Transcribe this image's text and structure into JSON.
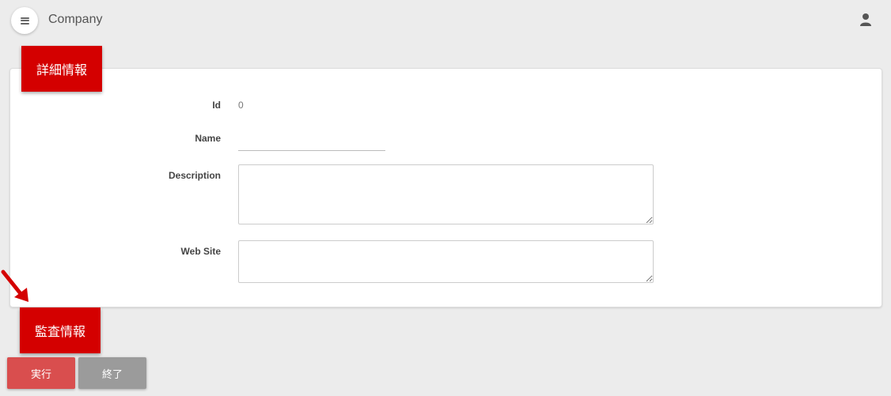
{
  "header": {
    "title": "Company"
  },
  "sections": {
    "detail_label": "詳細情報",
    "audit_label": "監査情報"
  },
  "form": {
    "id_label": "Id",
    "id_value": "0",
    "name_label": "Name",
    "name_value": "",
    "description_label": "Description",
    "description_value": "",
    "website_label": "Web Site",
    "website_value": ""
  },
  "buttons": {
    "run_label": "実行",
    "end_label": "終了"
  },
  "colors": {
    "accent": "#d40000",
    "run_button": "#d94e4e",
    "end_button": "#9b9b9b",
    "background": "#ececec"
  },
  "icons": {
    "menu": "menu-icon",
    "user": "user-icon",
    "annotation": "arrow-icon"
  }
}
